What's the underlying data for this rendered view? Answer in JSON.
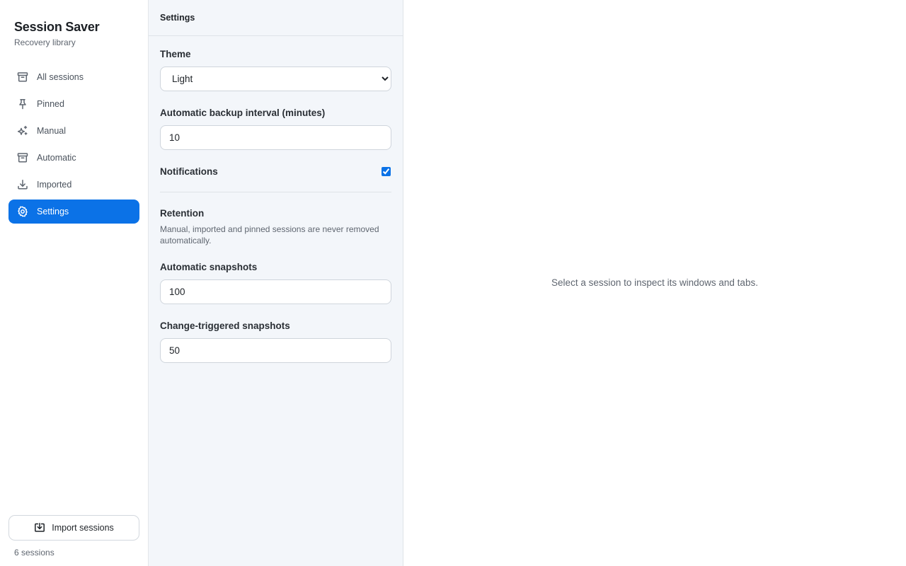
{
  "app": {
    "title": "Session Saver",
    "subtitle": "Recovery library"
  },
  "sidebar": {
    "items": [
      {
        "label": "All sessions",
        "icon": "archive-icon"
      },
      {
        "label": "Pinned",
        "icon": "pin-icon"
      },
      {
        "label": "Manual",
        "icon": "sparkles-icon"
      },
      {
        "label": "Automatic",
        "icon": "archive-icon"
      },
      {
        "label": "Imported",
        "icon": "download-icon"
      },
      {
        "label": "Settings",
        "icon": "gear-icon",
        "active": true
      }
    ],
    "import_label": "Import sessions",
    "count_text": "6 sessions"
  },
  "settings": {
    "header": "Settings",
    "theme_label": "Theme",
    "theme_value": "Light",
    "interval_label": "Automatic backup interval (minutes)",
    "interval_value": "10",
    "notifications_label": "Notifications",
    "notifications_checked": true,
    "retention_title": "Retention",
    "retention_note": "Manual, imported and pinned sessions are never removed automatically.",
    "auto_snapshots_label": "Automatic snapshots",
    "auto_snapshots_value": "100",
    "change_snapshots_label": "Change-triggered snapshots",
    "change_snapshots_value": "50"
  },
  "detail": {
    "empty_message": "Select a session to inspect its windows and tabs."
  },
  "colors": {
    "accent": "#0b72e7",
    "panel_bg": "#f3f6fa"
  }
}
